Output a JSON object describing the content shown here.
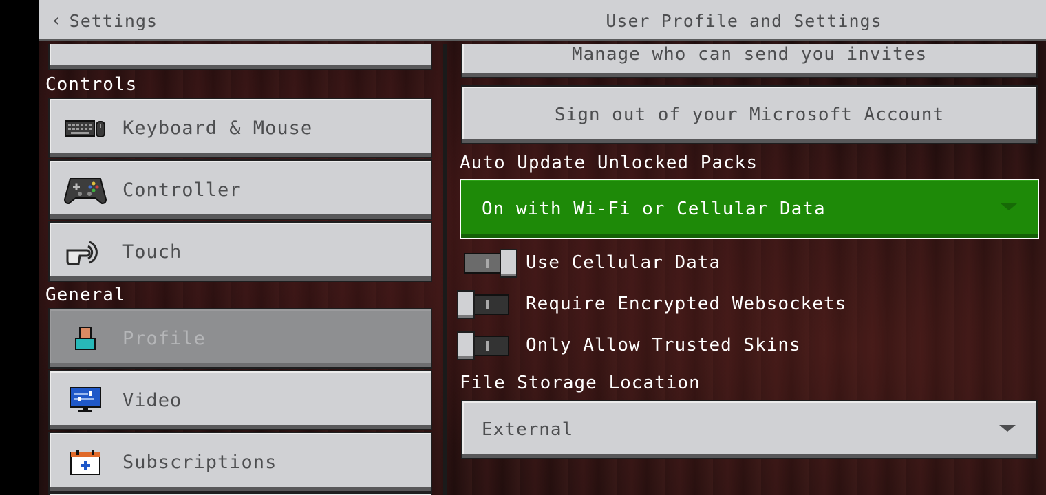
{
  "header": {
    "back_label": "Settings",
    "title": "User Profile and Settings"
  },
  "sidebar": {
    "partial_top_label": "",
    "sections": {
      "controls": "Controls",
      "general": "General"
    },
    "items": [
      {
        "label": "Keyboard & Mouse",
        "icon": "keyboard-mouse-icon"
      },
      {
        "label": "Controller",
        "icon": "controller-icon"
      },
      {
        "label": "Touch",
        "icon": "touch-icon"
      },
      {
        "label": "Profile",
        "icon": "profile-icon",
        "selected": true
      },
      {
        "label": "Video",
        "icon": "video-icon"
      },
      {
        "label": "Subscriptions",
        "icon": "subscriptions-icon"
      }
    ]
  },
  "content": {
    "partial_button_label": "Manage who can send you invites",
    "sign_out_label": "Sign out of your Microsoft Account",
    "auto_update_label": "Auto Update Unlocked Packs",
    "auto_update_value": "On with Wi-Fi or Cellular Data",
    "toggles": [
      {
        "label": "Use Cellular Data",
        "on": true
      },
      {
        "label": "Require Encrypted Websockets",
        "on": false
      },
      {
        "label": "Only Allow Trusted Skins",
        "on": false
      }
    ],
    "file_storage_label": "File Storage Location",
    "file_storage_value": "External"
  },
  "colors": {
    "accent_green": "#1e8a08",
    "button_grey": "#d0d1d4",
    "selected_grey": "#8e8f91"
  }
}
